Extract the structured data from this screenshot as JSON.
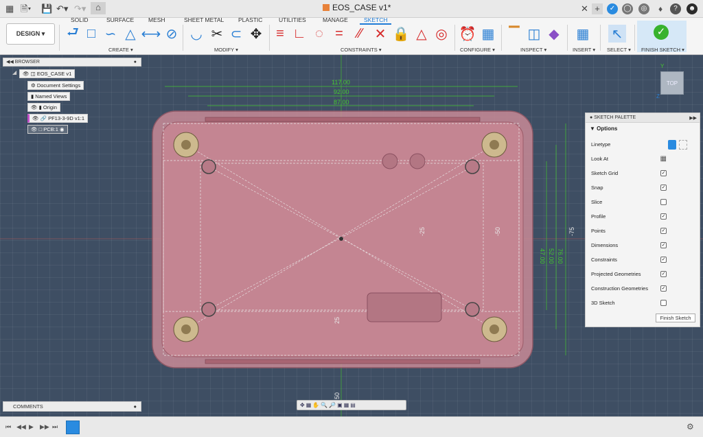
{
  "app": {
    "document_title": "EOS_CASE v1*"
  },
  "workspace_tabs": [
    "SOLID",
    "SURFACE",
    "MESH",
    "SHEET METAL",
    "PLASTIC",
    "UTILITIES",
    "MANAGE",
    "SKETCH"
  ],
  "design_button": "DESIGN ▾",
  "ribbon_groups": {
    "create": "CREATE ▾",
    "modify": "MODIFY ▾",
    "constraints": "CONSTRAINTS ▾",
    "configure": "CONFIGURE ▾",
    "inspect": "INSPECT ▾",
    "insert": "INSERT ▾",
    "select": "SELECT ▾",
    "finish": "FINISH SKETCH ▾"
  },
  "browser": {
    "title": "BROWSER",
    "items": [
      "EOS_CASE v1",
      "Document Settings",
      "Named Views",
      "Origin",
      "PF13-3-9D v1:1",
      "PCB:1"
    ]
  },
  "viewcube": {
    "face": "TOP",
    "axis_y": "Y",
    "axis_z": "Z"
  },
  "dimensions": {
    "d117": "117.00",
    "d92": "92.00",
    "d87": "87.00",
    "d47": "47.00",
    "d52": "52.00",
    "d76": "76.00",
    "m25": "-25",
    "m50": "-50",
    "m75": "-75",
    "p25": "25",
    "p50": "50"
  },
  "sketch_palette": {
    "title": "SKETCH PALETTE",
    "section": "Options",
    "rows": [
      "Linetype",
      "Look At",
      "Sketch Grid",
      "Snap",
      "Slice",
      "Profile",
      "Points",
      "Dimensions",
      "Constraints",
      "Projected Geometries",
      "Construction Geometries",
      "3D Sketch"
    ],
    "checked": [
      null,
      null,
      true,
      true,
      false,
      true,
      true,
      true,
      true,
      true,
      true,
      false
    ],
    "finish_button": "Finish Sketch"
  },
  "comments": {
    "title": "COMMENTS"
  },
  "colors": {
    "accent": "#1e7bd6",
    "finish_green": "#38b22d",
    "dimension": "#44c72f",
    "body": "#c98b97"
  }
}
